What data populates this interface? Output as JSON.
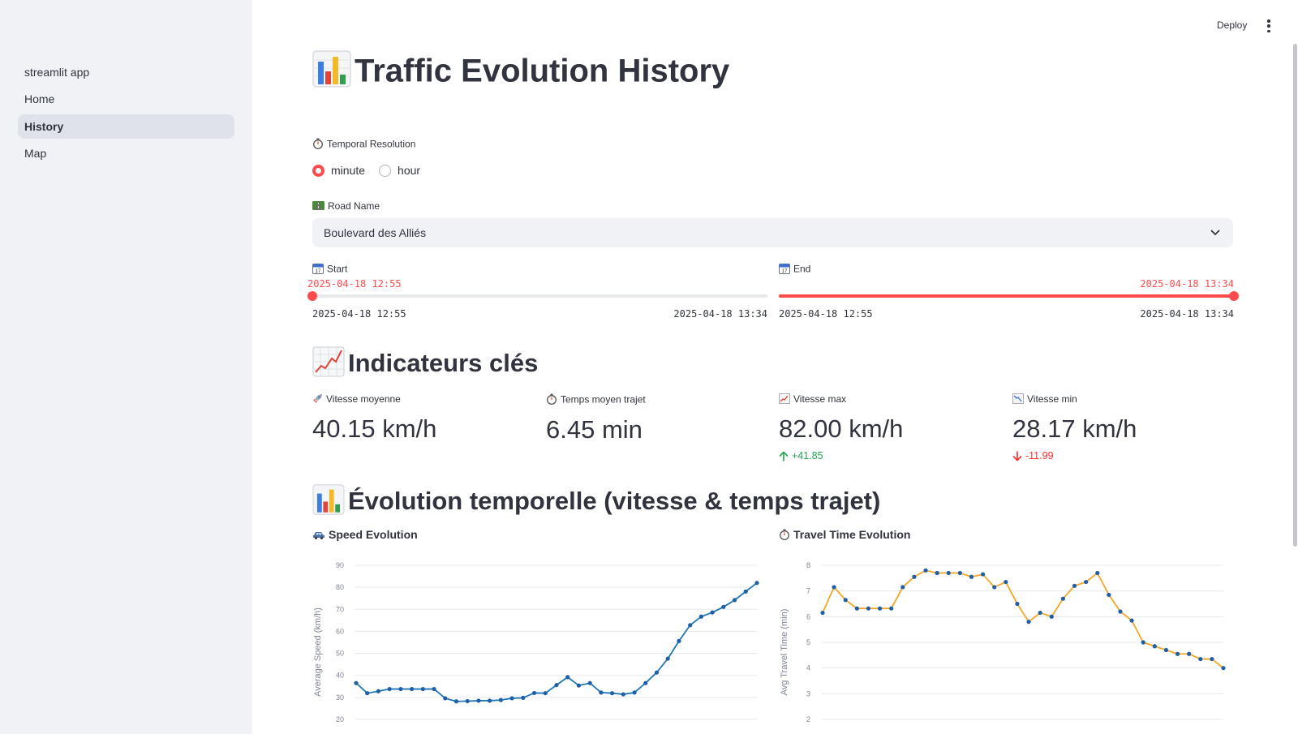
{
  "sidebar": {
    "items": [
      {
        "label": "streamlit app"
      },
      {
        "label": "Home"
      },
      {
        "label": "History",
        "active": true
      },
      {
        "label": "Map"
      }
    ]
  },
  "header": {
    "deploy_label": "Deploy",
    "menu_icon": "kebab-menu-icon"
  },
  "page": {
    "title": "Traffic Evolution History",
    "title_icon": "bar-chart-icon"
  },
  "filters": {
    "resolution_label": "Temporal Resolution",
    "resolution_icon": "stopwatch-icon",
    "resolution_options": [
      "minute",
      "hour"
    ],
    "resolution_selected": "minute",
    "road_label": "Road Name",
    "road_icon": "road-icon",
    "road_value": "Boulevard des Alliés",
    "start": {
      "label": "Start",
      "icon": "calendar-icon",
      "value": "2025-04-18 12:55",
      "min": "2025-04-18 12:55",
      "max": "2025-04-18 13:34",
      "position": 0
    },
    "end": {
      "label": "End",
      "icon": "calendar-icon",
      "value": "2025-04-18 13:34",
      "min": "2025-04-18 12:55",
      "max": "2025-04-18 13:34",
      "position": 1
    }
  },
  "indicators": {
    "heading": "Indicateurs clés",
    "heading_icon": "chart-increasing-icon",
    "metrics": [
      {
        "label": "Vitesse moyenne",
        "icon": "rocket-icon",
        "value": "40.15 km/h",
        "delta": ""
      },
      {
        "label": "Temps moyen trajet",
        "icon": "stopwatch-icon",
        "value": "6.45 min",
        "delta": ""
      },
      {
        "label": "Vitesse max",
        "icon": "chart-increasing-icon",
        "value": "82.00 km/h",
        "delta": "+41.85",
        "direction": "up"
      },
      {
        "label": "Vitesse min",
        "icon": "chart-decreasing-icon",
        "value": "28.17 km/h",
        "delta": "-11.99",
        "direction": "down"
      }
    ]
  },
  "evolution": {
    "heading": "Évolution temporelle (vitesse & temps trajet)",
    "heading_icon": "bar-chart-icon"
  },
  "colors": {
    "accent": "#ff4b4b",
    "speed_line": "#1f77b4",
    "travel_line": "#f5a623",
    "delta_up": "#21a352",
    "delta_down": "#ff2b2b"
  },
  "chart_data": [
    {
      "type": "line",
      "title": "Speed Evolution",
      "title_icon": "car-icon",
      "ylabel": "Average Speed (km/h)",
      "xlabel": "",
      "ylim": [
        20,
        90
      ],
      "yticks": [
        20,
        30,
        40,
        50,
        60,
        70,
        80,
        90
      ],
      "grid": true,
      "series": [
        {
          "values": [
            36.5,
            31.9,
            32.8,
            33.8,
            33.8,
            33.8,
            33.8,
            33.8,
            29.6,
            28.2,
            28.3,
            28.5,
            28.5,
            28.8,
            29.6,
            29.8,
            32.0,
            31.9,
            35.6,
            39.2,
            35.4,
            36.5,
            32.2,
            31.9,
            31.4,
            32.2,
            36.5,
            41.3,
            47.6,
            55.6,
            62.8,
            66.7,
            68.6,
            71.1,
            74.2,
            78.1,
            82.0
          ]
        }
      ]
    },
    {
      "type": "line",
      "title": "Travel Time Evolution",
      "title_icon": "stopwatch-icon",
      "ylabel": "Avg Travel Time (min)",
      "xlabel": "",
      "ylim": [
        2,
        8
      ],
      "yticks": [
        2,
        3,
        4,
        5,
        6,
        7,
        8
      ],
      "grid": true,
      "series": [
        {
          "values": [
            6.15,
            7.15,
            6.65,
            6.32,
            6.32,
            6.32,
            6.32,
            7.15,
            7.55,
            7.8,
            7.7,
            7.7,
            7.7,
            7.55,
            7.65,
            7.15,
            7.35,
            6.5,
            5.8,
            6.15,
            6.0,
            6.7,
            7.2,
            7.35,
            7.7,
            6.85,
            6.2,
            5.85,
            5.0,
            4.85,
            4.7,
            4.55,
            4.55,
            4.35,
            4.35,
            4.0
          ]
        }
      ]
    }
  ]
}
